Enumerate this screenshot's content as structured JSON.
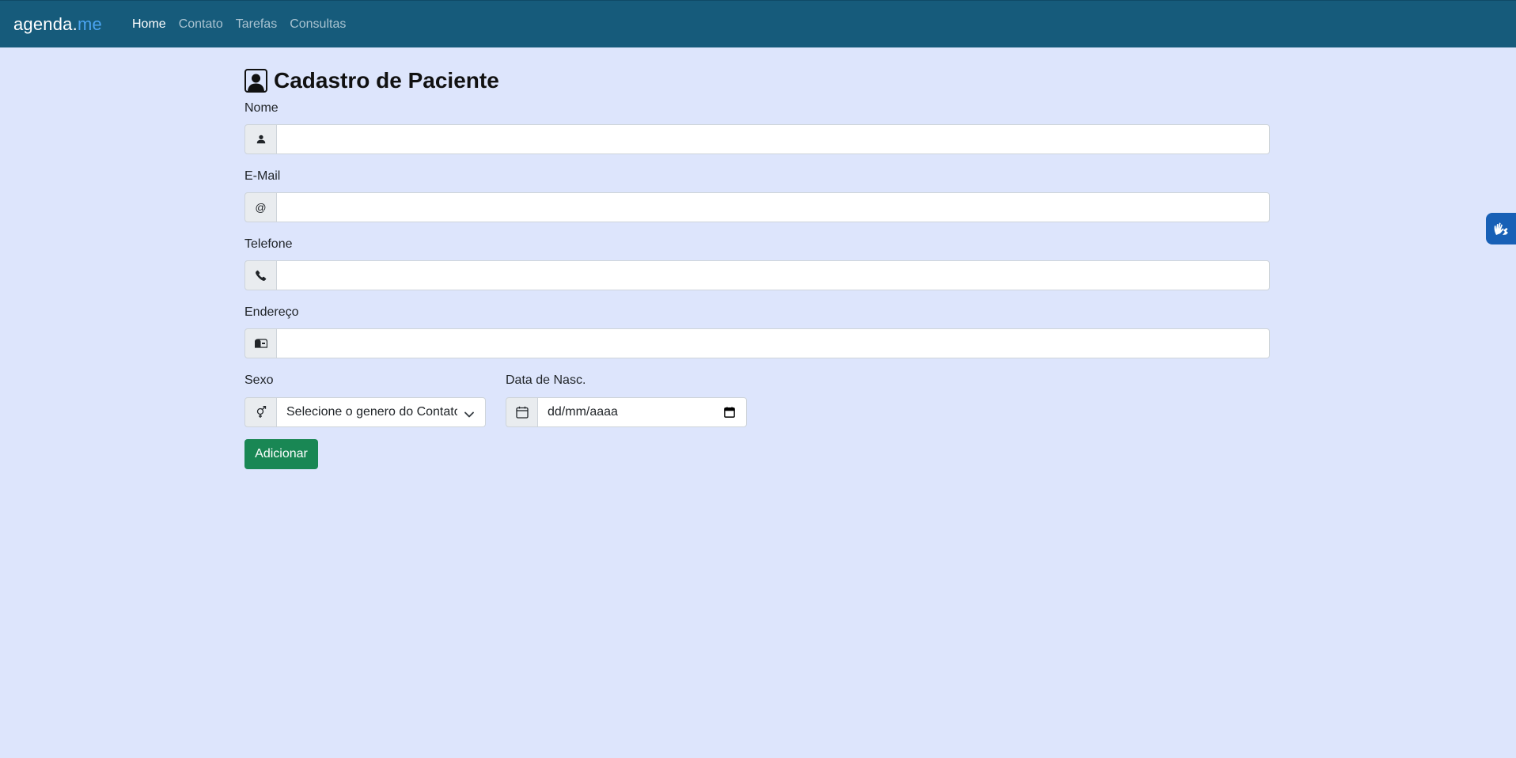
{
  "navbar": {
    "brand_prefix": "agenda.",
    "brand_suffix": "me",
    "links": [
      "Home",
      "Contato",
      "Tarefas",
      "Consultas"
    ],
    "active": "Home"
  },
  "form": {
    "title": "Cadastro de Paciente",
    "nome_label": "Nome",
    "email_label": "E-Mail",
    "email_addon": "@",
    "telefone_label": "Telefone",
    "endereco_label": "Endereço",
    "sexo_label": "Sexo",
    "sexo_value": "Selecione o genero do Contato",
    "nasc_label": "Data de Nasc.",
    "nasc_placeholder": "dd/mm/aaaa",
    "submit_label": "Adicionar"
  },
  "colors": {
    "navbar": "#165b7b",
    "background": "#dde5fc",
    "submit": "#198754",
    "brand_accent": "#4aa3f0"
  },
  "icons": [
    "person-badge-icon",
    "person-icon",
    "phone-icon",
    "mailbox-icon",
    "gender-icon",
    "calendar-icon",
    "chevron-down-icon",
    "sign-language-icon"
  ]
}
